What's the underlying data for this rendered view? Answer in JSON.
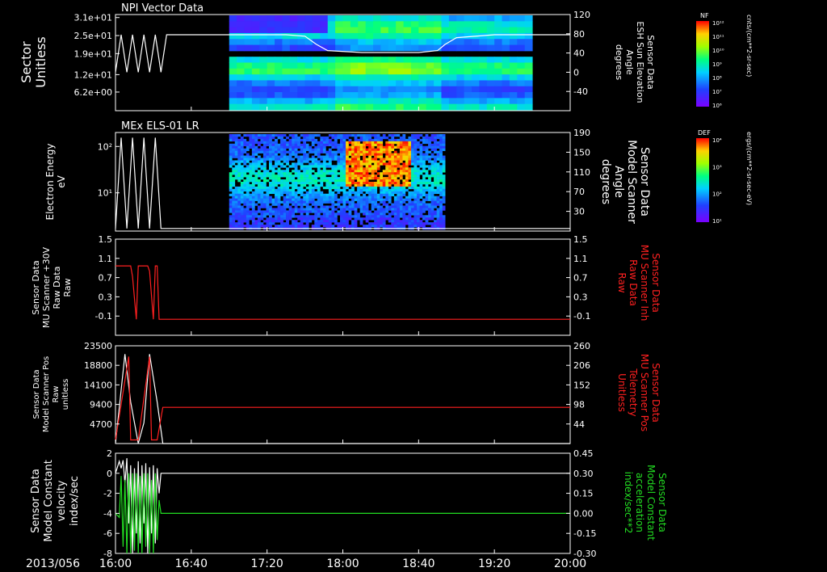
{
  "footer": {
    "date_label": "2013/056"
  },
  "time_axis": {
    "start": "16:00",
    "end": "20:00",
    "tick_labels": [
      "16:00",
      "16:40",
      "17:20",
      "18:00",
      "18:40",
      "19:20",
      "20:00"
    ],
    "tick_minutes": [
      0,
      40,
      80,
      120,
      160,
      200,
      240
    ]
  },
  "colorbars": [
    {
      "label": "NF",
      "units": "cnts/(cm**2-sr-sec)",
      "tick_labels": [
        "10¹²",
        "10¹¹",
        "10¹⁰",
        "10⁹",
        "10⁸",
        "10⁷",
        "10⁶"
      ]
    },
    {
      "label": "DEF",
      "units": "ergs/(cm**2-sr-sec-eV)",
      "tick_labels": [
        "10⁴",
        "10³",
        "10²",
        "10¹"
      ]
    }
  ],
  "colors": {
    "white_trace": "#ffffff",
    "red_trace": "#ff2020",
    "green_trace": "#22dd22",
    "frame": "#ffffff"
  },
  "chart_data": [
    {
      "type": "heatmap",
      "title": "NPI Vector Data",
      "ylabel_left": [
        "Sector",
        "Unitless"
      ],
      "left_ticks": [
        {
          "label": "3.1e+01",
          "value": 31
        },
        {
          "label": "2.5e+01",
          "value": 25
        },
        {
          "label": "1.9e+01",
          "value": 19
        },
        {
          "label": "1.2e+01",
          "value": 12
        },
        {
          "label": "6.2e+00",
          "value": 6.2
        }
      ],
      "ylim_left": [
        0,
        32
      ],
      "ylabel_right": [
        "Sensor Data",
        "ESH Sun Elevation",
        "Angle",
        "degrees"
      ],
      "right_ticks": [
        "120",
        "80",
        "40",
        "0",
        "-40"
      ],
      "ylim_right": [
        -80,
        120
      ],
      "series": [
        {
          "name": "ESH Sun Elevation Angle",
          "color": "white",
          "x": [
            0,
            3,
            6,
            9,
            12,
            15,
            18,
            21,
            24,
            27,
            28,
            29,
            30,
            60,
            90,
            100,
            106,
            112,
            130,
            160,
            170,
            174,
            180,
            200,
            240
          ],
          "y": [
            0,
            78,
            0,
            78,
            0,
            78,
            0,
            78,
            0,
            78,
            78,
            78,
            78,
            78,
            78,
            75,
            58,
            45,
            41,
            41,
            45,
            58,
            72,
            78,
            78
          ]
        }
      ],
      "spectrogram_span_minutes": [
        60,
        220
      ]
    },
    {
      "type": "heatmap",
      "title": "MEx ELS-01 LR",
      "ylabel_left": [
        "Electron Energy",
        "eV"
      ],
      "left_ticks": [
        {
          "label": "10²",
          "value": 100
        },
        {
          "label": "10¹",
          "value": 10
        }
      ],
      "ylim_left": [
        1.5,
        200
      ],
      "yscale_left": "log",
      "ylabel_right": [
        "Sensor Data",
        "Model Scanner",
        "Angle",
        "degrees"
      ],
      "right_ticks": [
        "190",
        "150",
        "110",
        "70",
        "30"
      ],
      "ylim_right": [
        0,
        190
      ],
      "series": [
        {
          "name": "Model Scanner Angle",
          "color": "white",
          "x": [
            0,
            3,
            6,
            9,
            12,
            15,
            18,
            21,
            24,
            240
          ],
          "y": [
            5,
            180,
            5,
            180,
            5,
            180,
            5,
            180,
            5,
            5
          ]
        }
      ],
      "spectrogram_span_minutes": [
        60,
        174
      ]
    },
    {
      "type": "line",
      "ylabel_left": [
        "Sensor Data",
        "MU Scanner +30V",
        "Raw Data",
        "Raw"
      ],
      "left_ticks": [
        "1.5",
        "1.1",
        "0.7",
        "0.3",
        "-0.1"
      ],
      "ylim_left": [
        -0.3,
        1.5
      ],
      "ylabel_right": [
        "Sensor Data",
        "MU Scanner Inh",
        "Raw Data",
        "Raw"
      ],
      "right_ticks": [
        "1.5",
        "1.1",
        "0.7",
        "0.3",
        "-0.1"
      ],
      "ylim_right": [
        -0.3,
        1.5
      ],
      "series": [
        {
          "name": "MU Scanner Inh Raw Data",
          "color": "red",
          "x": [
            0,
            8,
            9,
            11,
            12,
            14,
            15,
            17,
            18,
            20,
            21,
            22,
            23,
            24,
            240
          ],
          "y": [
            1.0,
            1.0,
            0.8,
            0.0,
            1.0,
            1.0,
            1.0,
            1.0,
            0.9,
            0.0,
            1.0,
            1.0,
            0.0,
            0.0,
            0.0
          ]
        }
      ]
    },
    {
      "type": "line",
      "ylabel_left": [
        "Sensor Data",
        "Model Scanner Pos",
        "Raw",
        "unitless"
      ],
      "left_ticks": [
        "23500",
        "18800",
        "14100",
        "9400",
        "4700"
      ],
      "ylim_left": [
        0,
        23500
      ],
      "ylabel_right": [
        "Sensor Data",
        "MU Scanner Pos",
        "Telemetry",
        "Unitless"
      ],
      "right_ticks": [
        "260",
        "206",
        "152",
        "98",
        "44"
      ],
      "ylim_right": [
        -10,
        260
      ],
      "series": [
        {
          "name": "Model Scanner Pos",
          "color": "white",
          "x": [
            0,
            5,
            8,
            12,
            15,
            18,
            22,
            25,
            240
          ],
          "y": [
            0,
            21500,
            10000,
            0,
            5000,
            21500,
            10000,
            0,
            0
          ]
        },
        {
          "name": "MU Scanner Pos Telemetry",
          "color": "red",
          "x": [
            0,
            7,
            8,
            12,
            18,
            19,
            22,
            25,
            26,
            240
          ],
          "y": [
            0,
            230,
            0,
            0,
            230,
            0,
            0,
            90,
            90,
            90
          ]
        }
      ]
    },
    {
      "type": "line",
      "ylabel_left": [
        "Sensor Data",
        "Model Constant",
        "velocity",
        "index/sec"
      ],
      "left_ticks": [
        "2",
        "0",
        "-2",
        "-4",
        "-6",
        "-8"
      ],
      "ylim_left": [
        -8,
        2
      ],
      "ylabel_right": [
        "Sensor Data",
        "Model Constant",
        "acceleration",
        "index/sec**2"
      ],
      "right_ticks": [
        "0.45",
        "0.30",
        "0.15",
        "0.00",
        "-0.15",
        "-0.30"
      ],
      "ylim_right": [
        -0.3,
        0.45
      ],
      "series": [
        {
          "name": "Model Constant velocity",
          "color": "white",
          "x": [
            0,
            2,
            3,
            4,
            5,
            6,
            7,
            8,
            9,
            10,
            11,
            12,
            13,
            14,
            15,
            16,
            17,
            18,
            19,
            20,
            21,
            22,
            23,
            24,
            240
          ],
          "y": [
            0,
            1.2,
            0.5,
            1.3,
            -1,
            1.5,
            -5,
            0.8,
            -8,
            0.5,
            -6,
            1.2,
            -7,
            0.8,
            -5,
            1.0,
            -8,
            0.6,
            -6,
            0.8,
            -7,
            0.5,
            -2,
            0,
            0
          ]
        },
        {
          "name": "Model Constant acceleration",
          "color": "green",
          "x": [
            0,
            2,
            3,
            4,
            5,
            6,
            7,
            8,
            9,
            10,
            11,
            12,
            13,
            14,
            15,
            16,
            17,
            18,
            19,
            20,
            21,
            22,
            23,
            24,
            240
          ],
          "y": [
            0,
            -0.03,
            0.28,
            -0.25,
            0.25,
            -0.3,
            0.3,
            -0.3,
            0.3,
            -0.28,
            0.3,
            -0.3,
            0.28,
            -0.3,
            0.3,
            -0.25,
            0.3,
            -0.3,
            0.25,
            -0.3,
            0.3,
            -0.2,
            0.1,
            0,
            0
          ]
        }
      ]
    }
  ]
}
